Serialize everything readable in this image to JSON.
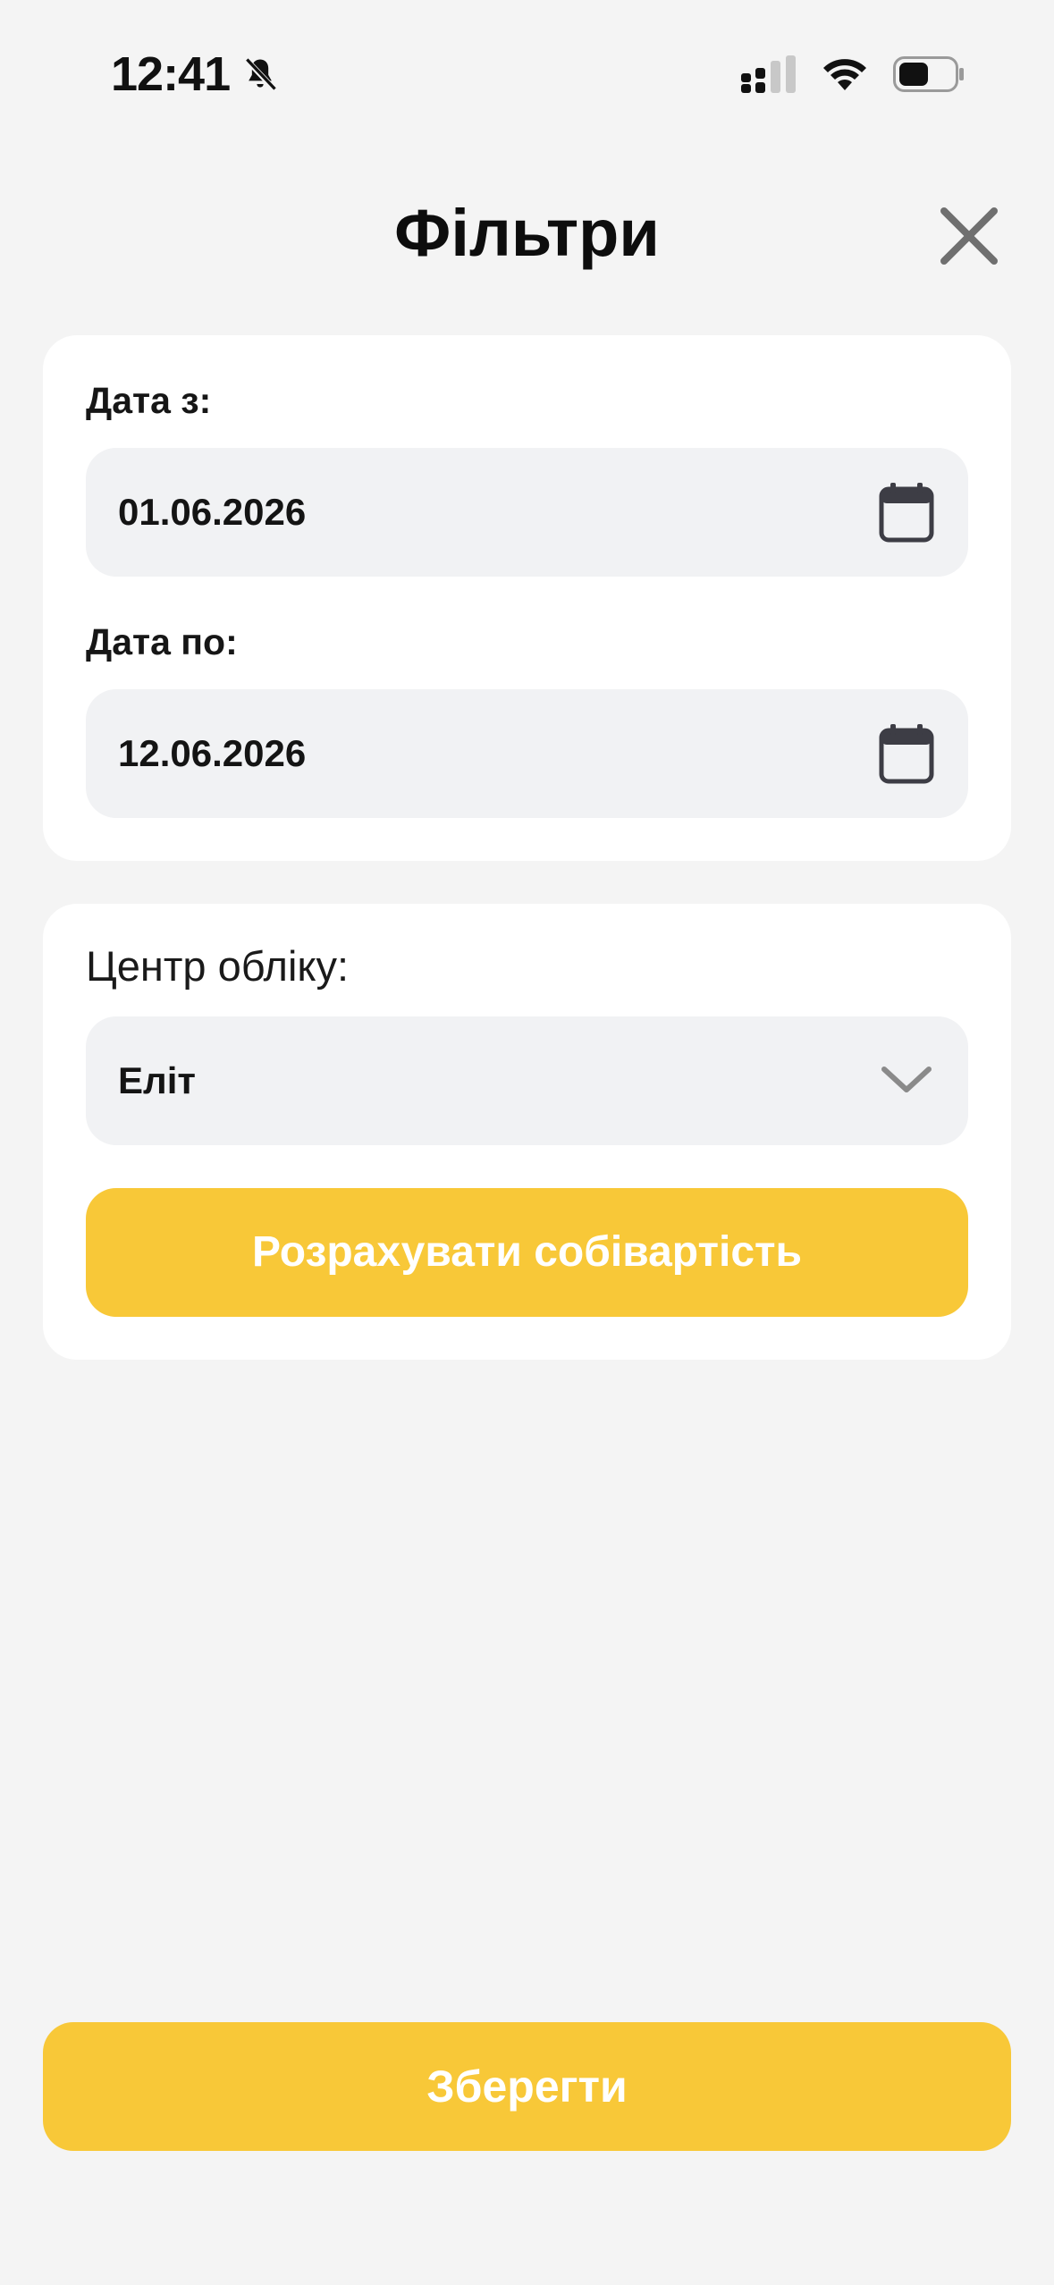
{
  "status_bar": {
    "time": "12:41",
    "icons": [
      "bell-slash-icon",
      "signal-icon",
      "wifi-icon",
      "battery-icon"
    ]
  },
  "header": {
    "title": "Фільтри",
    "close_icon": "close-icon"
  },
  "dates": {
    "from_label": "Дата з:",
    "from_value": "01.06.2026",
    "to_label": "Дата по:",
    "to_value": "12.06.2026",
    "icon": "calendar-icon"
  },
  "center": {
    "label": "Центр обліку:",
    "selected": "Еліт",
    "icon": "chevron-down-icon",
    "calc_button": "Розрахувати собівартість"
  },
  "footer": {
    "save_button": "Зберегти"
  },
  "colors": {
    "background": "#f4f4f4",
    "card": "#ffffff",
    "input": "#f1f2f4",
    "accent": "#f8c838"
  }
}
